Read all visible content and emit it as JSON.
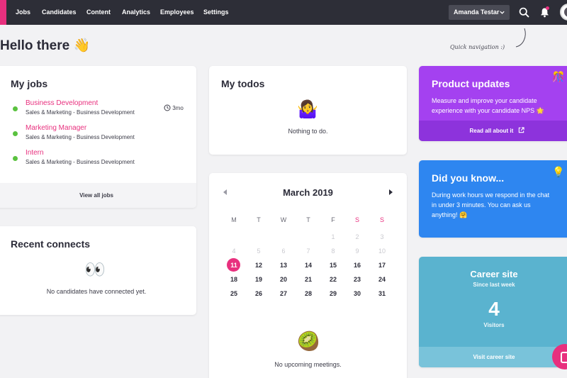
{
  "nav": {
    "items": [
      "Jobs",
      "Candidates",
      "Content",
      "Analytics",
      "Employees",
      "Settings"
    ],
    "user_name": "Amanda Testar"
  },
  "greeting": "Hello there 👋",
  "quick_nav_hint": "Quick navigation :)",
  "my_jobs": {
    "title": "My jobs",
    "age": "3mo",
    "jobs": [
      {
        "title": "Business Development",
        "sub": "Sales & Marketing - Business Development"
      },
      {
        "title": "Marketing Manager",
        "sub": "Sales & Marketing - Business Development"
      },
      {
        "title": "Intern",
        "sub": "Sales & Marketing - Business Development"
      }
    ],
    "footer": "View all jobs"
  },
  "recent_connects": {
    "title": "Recent connects",
    "emoji": "👀",
    "empty": "No candidates have connected yet."
  },
  "todos": {
    "title": "My todos",
    "emoji": "🤷‍♀️",
    "empty": "Nothing to do."
  },
  "calendar": {
    "month": "March 2019",
    "weekdays": [
      "M",
      "T",
      "W",
      "T",
      "F",
      "S",
      "S"
    ],
    "weeks": [
      [
        null,
        null,
        null,
        null,
        "1",
        "2",
        "3"
      ],
      [
        "4",
        "5",
        "6",
        "7",
        "8",
        "9",
        "10"
      ],
      [
        "11",
        "12",
        "13",
        "14",
        "15",
        "16",
        "17"
      ],
      [
        "18",
        "19",
        "20",
        "21",
        "22",
        "23",
        "24"
      ],
      [
        "25",
        "26",
        "27",
        "28",
        "29",
        "30",
        "31"
      ]
    ],
    "today": "11",
    "emoji": "🥝",
    "empty": "No upcoming meetings."
  },
  "product_updates": {
    "title": "Product updates",
    "body": "Measure and improve your candidate experience with your candidate NPS 🌟",
    "link": "Read all about it",
    "color": "#a441f0",
    "link_color": "#8d33dc"
  },
  "did_you_know": {
    "title": "Did you know...",
    "body": "During work hours we respond in the chat in under 3 minutes. You can ask us anything! 🤗",
    "color": "#2e86f0"
  },
  "career_site": {
    "title": "Career site",
    "subtitle": "Since last week",
    "count": "4",
    "count_label": "Visitors",
    "link": "Visit career site",
    "color": "#5ab3cf",
    "link_color": "#79c3da"
  },
  "colors": {
    "accent": "#e8307e",
    "nav_bg": "#2d2e37",
    "status_green": "#5ac23f"
  }
}
